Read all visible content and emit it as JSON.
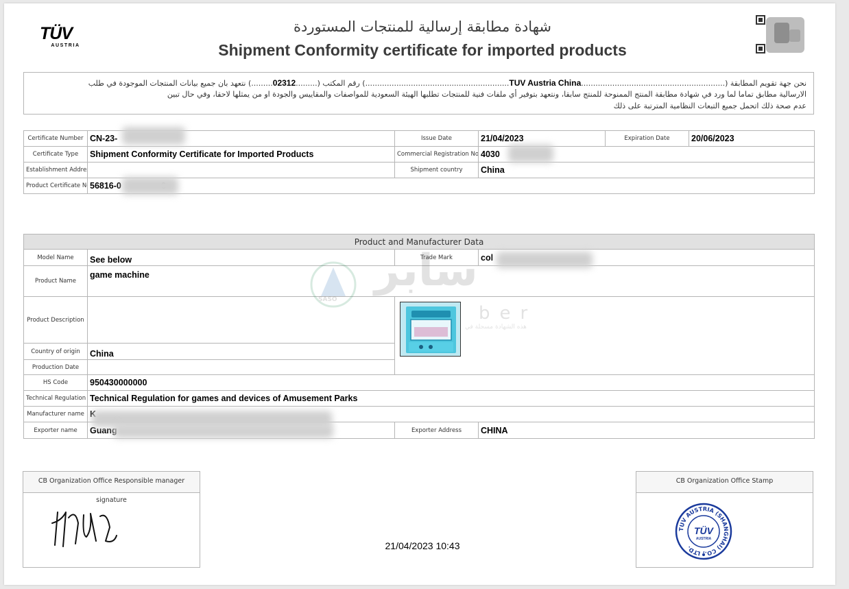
{
  "header": {
    "title_ar": "شهادة مطابقة إرسالية للمنتجات المستوردة",
    "title_en": "Shipment Conformity certificate for imported products",
    "logo_brand": "TÜV",
    "logo_sub": "AUSTRIA"
  },
  "declaration": {
    "line1_pre": "نحن جهة تقويم المطابقة (",
    "body_name": "TUV Austria China",
    "line1_mid": ") رقم المكتب (",
    "office_no": "02312",
    "line1_post": ") نتعهد بان جميع بيانات المنتجات الموجودة في طلب",
    "line2": "الارسالية مطابق تماما لما ورد في شهادة مطابقة المنتج الممنوحة للمنتج سابقا، ونتعهد بتوفير أي ملفات فنية للمنتجات تطلبها الهيئة السعودية للمواصفات والمقاييس والجودة او من يمثلها لاحقا، وفي حال تبين",
    "line3": "عدم صحة ذلك اتحمل جميع التبعات النظامية المترتبة على ذلك"
  },
  "certificate": {
    "number_label": "Certificate  Number",
    "number_value": "CN-23-",
    "issue_date_label": "Issue Date",
    "issue_date": "21/04/2023",
    "expiration_label": "Expiration Date",
    "expiration_date": "20/06/2023",
    "type_label": "Certificate Type",
    "type_value": "Shipment Conformity Certificate for Imported Products",
    "commercial_reg_label": "Commercial Registration No",
    "commercial_reg_value": "4030",
    "establishment_label": "Establishment Address",
    "establishment_value": "",
    "shipment_country_label": "Shipment country",
    "shipment_country_value": "China",
    "product_cert_label": "Product Certificate No.",
    "product_cert_value": "56816-0",
    "product_cert_suffix": "6"
  },
  "product": {
    "section_title": "Product and Manufacturer Data",
    "model_label": "Model Name",
    "model_value": "See below",
    "trademark_label": "Trade Mark",
    "trademark_value": "col",
    "name_label": "Product Name",
    "name_value": "game machine",
    "description_label": "Product Description",
    "description_value": "",
    "origin_label": "Country of origin",
    "origin_value": "China",
    "production_date_label": "Production Date",
    "production_date_value": "",
    "hs_label": "HS Code",
    "hs_value": "950430000000",
    "tech_reg_label": "Technical Regulation",
    "tech_reg_value": "Technical Regulation for games and devices of Amusement Parks",
    "manufacturer_label": "Manufacturer name",
    "manufacturer_value": "K",
    "exporter_label": "Exporter name",
    "exporter_value": "Guang",
    "exporter_address_label": "Exporter Address",
    "exporter_address_value": "CHINA"
  },
  "watermark": {
    "text_ar": "سابر",
    "text_en": "ber",
    "badge": "SASO",
    "caption_ar": "هذه الشهادة مسجلة في"
  },
  "signature": {
    "box_title": "CB Organization Office Responsible manager signature"
  },
  "stamp": {
    "box_title": "CB Organization Office Stamp",
    "ring_text": "TUV AUSTRIA (SHANGHAI) CO., LTD.",
    "brand": "TÜV",
    "brand_sub": "AUSTRIA"
  },
  "timestamp": "21/04/2023 10:43",
  "colors": {
    "brand_red": "#d4121e",
    "stamp_blue": "#1a3a9c",
    "header_gray": "#e1e1e1",
    "border": "#b5b5b5"
  }
}
